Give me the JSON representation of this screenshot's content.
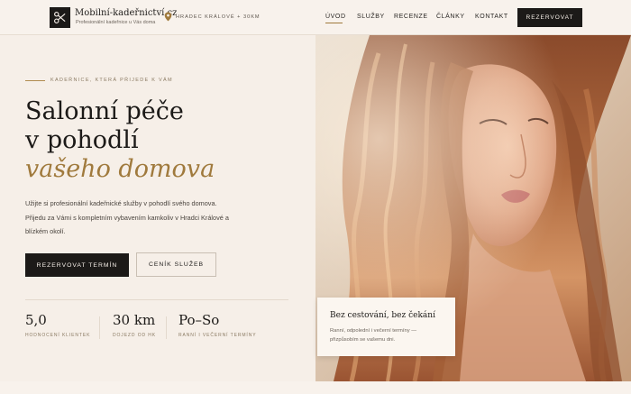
{
  "brand": {
    "name": "Mobilní-kadeřnictví.cz",
    "tagline": "Profesionální kadeřnice u Vás doma"
  },
  "location": {
    "text": "HRADEC KRÁLOVÉ + 30KM",
    "icon": "map-pin-icon"
  },
  "nav": [
    {
      "label": "ÚVOD",
      "active": true
    },
    {
      "label": "SLUŽBY",
      "active": false
    },
    {
      "label": "RECENZE",
      "active": false
    },
    {
      "label": "ČLÁNKY",
      "active": false
    },
    {
      "label": "KONTAKT",
      "active": false
    }
  ],
  "header_cta": "REZERVOVAT",
  "hero": {
    "eyebrow": "KADEŘNICE, KTERÁ PŘIJEDE K VÁM",
    "title_line1": "Salonní péče",
    "title_line2": "v pohodlí",
    "title_line3": "vašeho domova",
    "description": "Užijte si profesionální kadeřnické služby v pohodlí svého domova. Přijedu za Vámi s kompletním vybavením kamkoliv v Hradci Králové a blízkém okolí.",
    "primary_button": "REZERVOVAT TERMÍN",
    "secondary_button": "CENÍK SLUŽEB"
  },
  "stats": [
    {
      "value": "5,0",
      "label": "HODNOCENÍ KLIENTEK"
    },
    {
      "value": "30 km",
      "label": "DOJEZD OD HK"
    },
    {
      "value": "Po–So",
      "label": "RANNÍ I VEČERNÍ TERMÍNY"
    }
  ],
  "card": {
    "title": "Bez cestování, bez čekání",
    "text": "Ranní, odpolední i večerní termíny — přizpůsobím se vašemu dni."
  },
  "colors": {
    "accent": "#a07a3d",
    "dark": "#1c1a18",
    "background": "#f6efe8"
  }
}
